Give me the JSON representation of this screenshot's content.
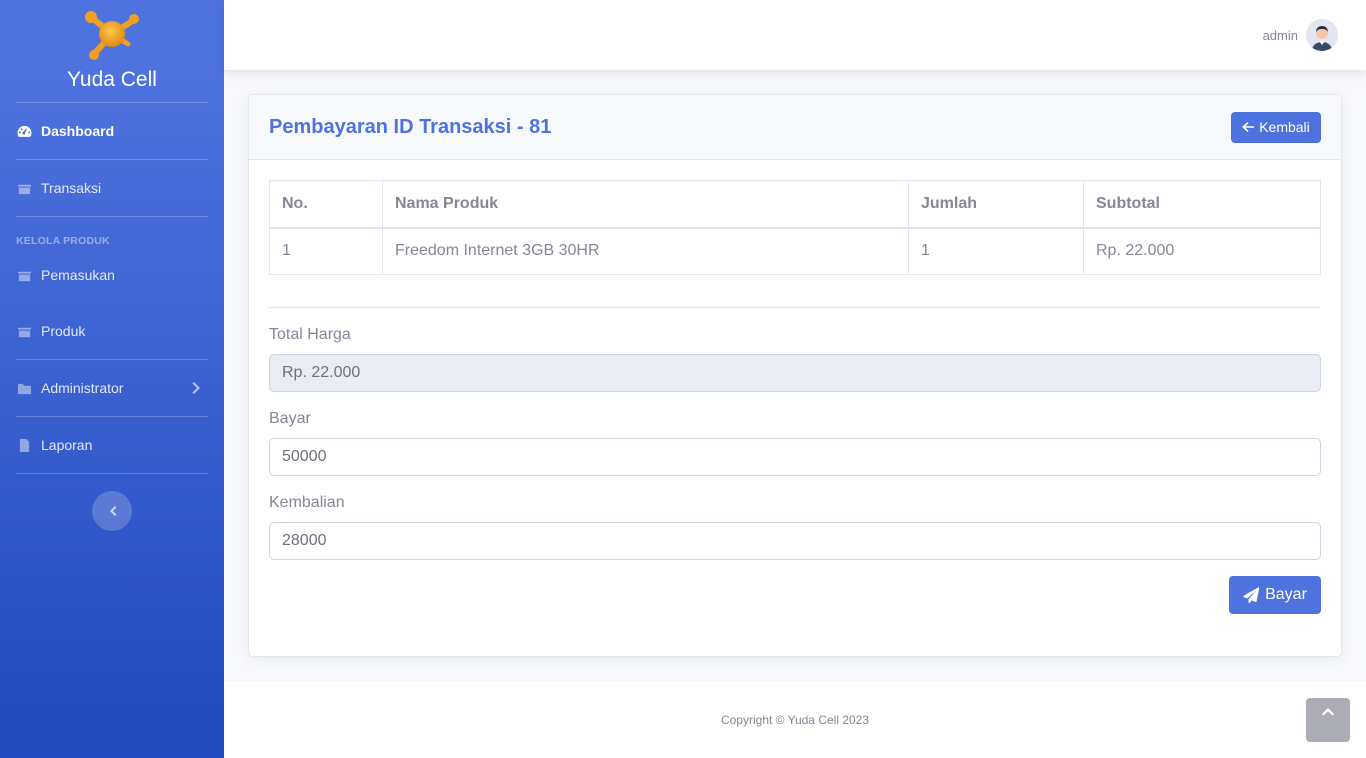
{
  "brand": {
    "name": "Yuda Cell",
    "logo_icon": "molecule-logo-icon",
    "logo_color": "#f0a020"
  },
  "sidebar": {
    "items": [
      {
        "label": "Dashboard",
        "icon": "tachometer-icon",
        "active": true
      },
      {
        "label": "Transaksi",
        "icon": "folder-icon"
      },
      {
        "label": "Pemasukan",
        "icon": "folder-icon"
      },
      {
        "label": "Produk",
        "icon": "folder-icon"
      },
      {
        "label": "Administrator",
        "icon": "folder-icon",
        "has_submenu": true
      },
      {
        "label": "Laporan",
        "icon": "file-icon"
      }
    ],
    "heading": "KELOLA PRODUK",
    "toggle_icon": "chevron-left-icon"
  },
  "topbar": {
    "user_name": "admin"
  },
  "card": {
    "title": "Pembayaran ID Transaksi - 81",
    "back_label": "Kembali",
    "table": {
      "headers": [
        "No.",
        "Nama Produk",
        "Jumlah",
        "Subtotal"
      ],
      "rows": [
        {
          "no": "1",
          "nama": "Freedom Internet 3GB 30HR",
          "jumlah": "1",
          "subtotal": "Rp. 22.000"
        }
      ]
    },
    "total_label": "Total Harga",
    "total_value": "Rp. 22.000",
    "bayar_label": "Bayar",
    "bayar_value": "50000",
    "kembalian_label": "Kembalian",
    "kembalian_value": "28000",
    "pay_label": "Bayar"
  },
  "footer": {
    "copyright": "Copyright © Yuda Cell 2023"
  },
  "colors": {
    "primary": "#4e73df",
    "primary_dark": "#224abe"
  }
}
